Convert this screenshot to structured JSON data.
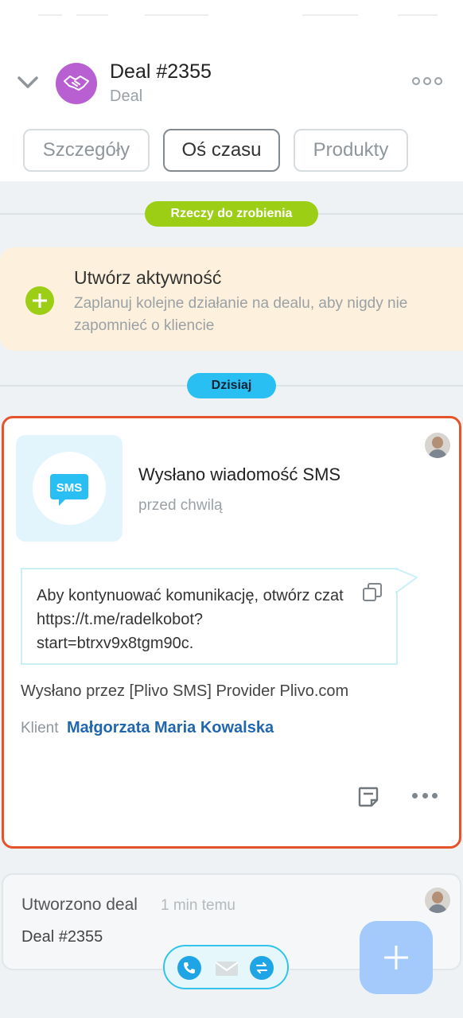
{
  "header": {
    "deal_title": "Deal #2355",
    "deal_subtitle": "Deal",
    "icons": {
      "collapse": "chevron-down-icon",
      "avatar": "handshake-icon",
      "more": "more-icon"
    }
  },
  "tabs": [
    {
      "label": "Szczegóły",
      "active": false
    },
    {
      "label": "Oś czasu",
      "active": true
    },
    {
      "label": "Produkty",
      "active": false
    }
  ],
  "timeline": {
    "todo_pill": "Rzeczy do zrobienia",
    "today_pill": "Dzisiaj"
  },
  "create_activity": {
    "title": "Utwórz aktywność",
    "description": "Zaplanuj kolejne działanie na dealu, aby nigdy nie zapomnieć o kliencie",
    "icon": "plus-circle-icon"
  },
  "sms_event": {
    "icon_text": "SMS",
    "title": "Wysłano wiadomość SMS",
    "time": "przed chwilą",
    "message": "Aby kontynuować komunikację, otwórz czat https://t.me/radelkobot?start=btrxv9x8tgm90c.",
    "sent_by": "Wysłano przez [Plivo SMS] Provider Plivo.com",
    "client_label": "Klient",
    "client_name": "Małgorzata Maria Kowalska"
  },
  "created_event": {
    "title": "Utworzono deal",
    "time": "1 min temu",
    "deal": "Deal #2355"
  },
  "colors": {
    "accent_green": "#9dce16",
    "accent_blue": "#29bff2",
    "highlight_border": "#e5532b",
    "link": "#2066b0",
    "deal_avatar": "#b85fd1"
  }
}
